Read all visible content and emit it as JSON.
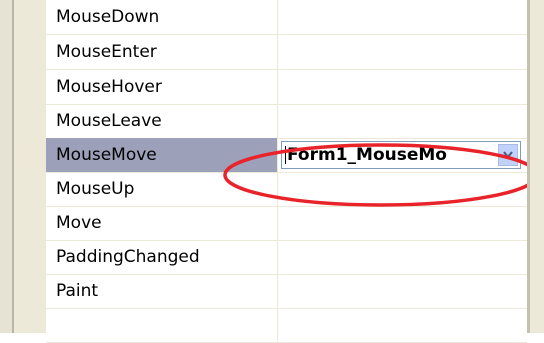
{
  "events": [
    {
      "name": "MouseDown",
      "value": ""
    },
    {
      "name": "MouseEnter",
      "value": ""
    },
    {
      "name": "MouseHover",
      "value": ""
    },
    {
      "name": "MouseLeave",
      "value": ""
    },
    {
      "name": "MouseMove",
      "value": "Form1_MouseMo"
    },
    {
      "name": "MouseUp",
      "value": ""
    },
    {
      "name": "Move",
      "value": ""
    },
    {
      "name": "PaddingChanged",
      "value": ""
    },
    {
      "name": "Paint",
      "value": ""
    }
  ],
  "selected_index": 4,
  "dropdown_icon": "chevron-down-icon",
  "colors": {
    "selection": "#9ca0b8",
    "annotation": "#e8232a",
    "dropdown_button": "#c1d3fb"
  }
}
